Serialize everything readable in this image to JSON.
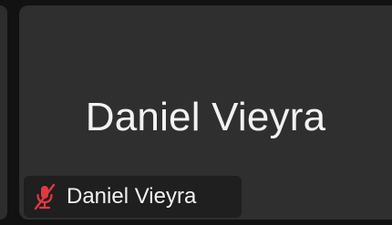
{
  "participant": {
    "display_name": "Daniel Vieyra",
    "tag_name": "Daniel Vieyra",
    "mic_state": "muted",
    "mic_icon": "mic-off-icon"
  },
  "colors": {
    "tile_background": "#2f2f2f",
    "muted_accent": "#e03a3e",
    "text": "#f2f2f2"
  }
}
